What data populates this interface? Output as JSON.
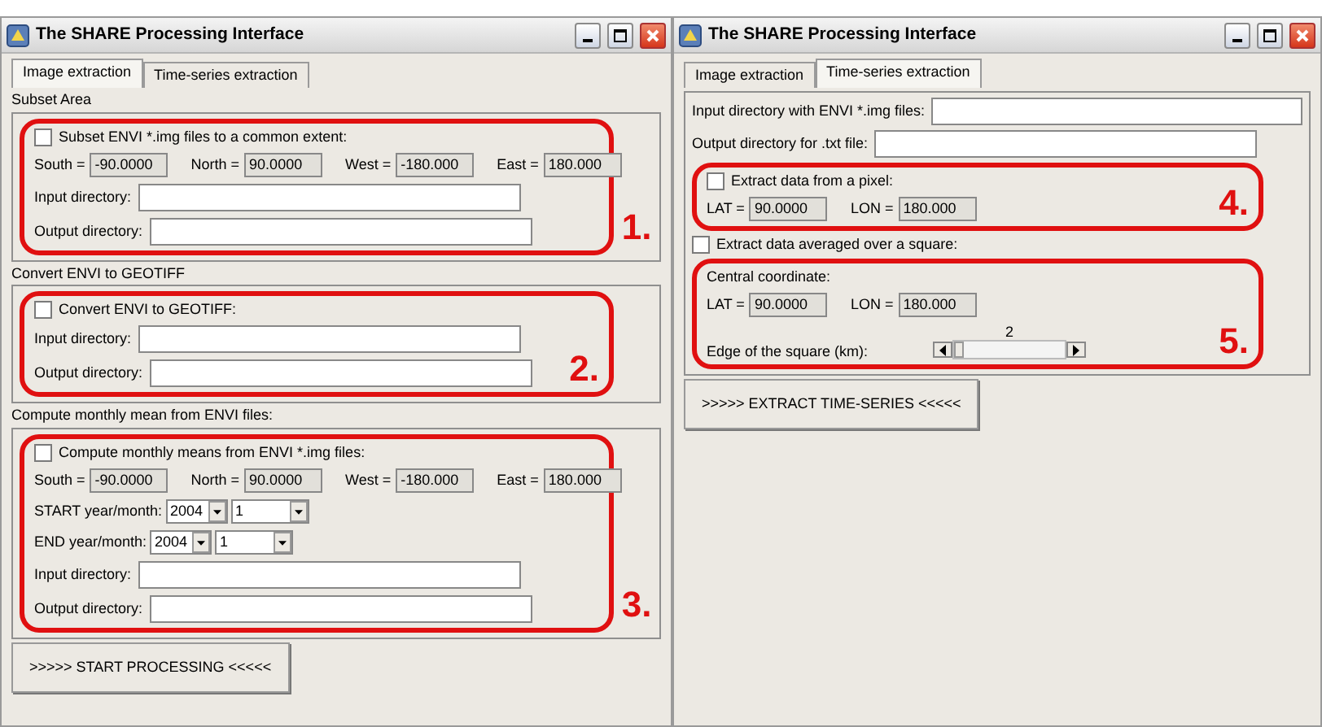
{
  "windows": [
    {
      "title": "The SHARE Processing Interface",
      "tabs": [
        {
          "label": "Image extraction",
          "selected": true
        },
        {
          "label": "Time-series extraction",
          "selected": false
        }
      ],
      "blocks": [
        {
          "kind": "frame",
          "caption": "Subset Area",
          "rows": [
            {
              "kind": "callout",
              "number": "1.",
              "rows": [
                {
                  "kind": "checkbox",
                  "label": "Subset ENVI *.img files to a common extent:",
                  "checked": false
                },
                {
                  "kind": "coords",
                  "items": [
                    {
                      "label": "South =",
                      "value": "-90.0000"
                    },
                    {
                      "label": "North =",
                      "value": "90.0000"
                    },
                    {
                      "label": "West =",
                      "value": "-180.000"
                    },
                    {
                      "label": "East =",
                      "value": "180.000"
                    }
                  ]
                },
                {
                  "kind": "field",
                  "label": "Input directory:"
                },
                {
                  "kind": "field",
                  "label": "Output directory:"
                }
              ]
            }
          ]
        },
        {
          "kind": "frame",
          "caption": "Convert ENVI to GEOTIFF",
          "rows": [
            {
              "kind": "callout",
              "number": "2.",
              "rows": [
                {
                  "kind": "checkbox",
                  "label": "Convert ENVI to GEOTIFF:",
                  "checked": false
                },
                {
                  "kind": "field",
                  "label": "Input directory:"
                },
                {
                  "kind": "field",
                  "label": "Output directory:"
                }
              ]
            }
          ]
        },
        {
          "kind": "frame",
          "caption": "Compute monthly mean from ENVI files:",
          "rows": [
            {
              "kind": "callout",
              "number": "3.",
              "rows": [
                {
                  "kind": "checkbox",
                  "label": "Compute monthly means from ENVI *.img files:",
                  "checked": false
                },
                {
                  "kind": "coords",
                  "items": [
                    {
                      "label": "South =",
                      "value": "-90.0000"
                    },
                    {
                      "label": "North =",
                      "value": "90.0000"
                    },
                    {
                      "label": "West =",
                      "value": "-180.000"
                    },
                    {
                      "label": "East =",
                      "value": "180.000"
                    }
                  ]
                },
                {
                  "kind": "date",
                  "label": "START year/month:",
                  "year": "2004",
                  "month": "1"
                },
                {
                  "kind": "date",
                  "label": "END year/month:",
                  "year": "2004",
                  "month": "1"
                },
                {
                  "kind": "field",
                  "label": "Input directory:"
                },
                {
                  "kind": "field",
                  "label": "Output directory:"
                }
              ]
            }
          ]
        },
        {
          "kind": "button",
          "label": ">>>>> START PROCESSING <<<<<"
        }
      ]
    },
    {
      "title": "The SHARE Processing Interface",
      "tabs": [
        {
          "label": "Image extraction",
          "selected": false
        },
        {
          "label": "Time-series extraction",
          "selected": true
        }
      ],
      "blocks": [
        {
          "kind": "frame",
          "rows": [
            {
              "kind": "field",
              "label": "Input directory with ENVI *.img files:"
            },
            {
              "kind": "field",
              "label": "Output directory for .txt file:"
            },
            {
              "kind": "callout",
              "number": "4.",
              "rows": [
                {
                  "kind": "checkbox",
                  "label": "Extract data from a pixel:",
                  "checked": false
                },
                {
                  "kind": "coords",
                  "items": [
                    {
                      "label": "LAT =",
                      "value": "90.0000"
                    },
                    {
                      "label": "LON =",
                      "value": "180.000"
                    }
                  ]
                }
              ]
            },
            {
              "kind": "checkbox",
              "label": "Extract data averaged over a square:",
              "checked": false
            },
            {
              "kind": "callout",
              "number": "5.",
              "rows": [
                {
                  "kind": "label",
                  "label": "Central coordinate:"
                },
                {
                  "kind": "coords",
                  "items": [
                    {
                      "label": "LAT =",
                      "value": "90.0000"
                    },
                    {
                      "label": "LON =",
                      "value": "180.000"
                    }
                  ]
                },
                {
                  "kind": "slider",
                  "label": "Edge of the square (km):",
                  "reading": "2",
                  "level": 0
                }
              ]
            }
          ]
        },
        {
          "kind": "button",
          "label": ">>>>> EXTRACT TIME-SERIES <<<<<"
        }
      ]
    }
  ]
}
